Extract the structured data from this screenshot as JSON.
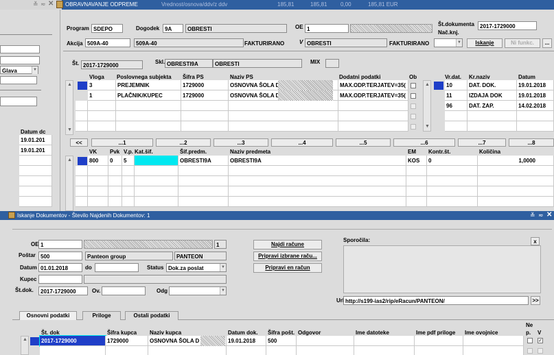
{
  "top_window": {
    "title": "OBRAVNAVANJE ODPREME",
    "title_info": "Vrednost/osnova/ddv/z ddv",
    "title_nums": [
      "185,81",
      "185,81",
      "0,00",
      "185,81 EUR"
    ]
  },
  "left_panel": {
    "glava": "Glava",
    "datum_header": "Datum dc",
    "datum_rows": [
      "19.01.201",
      "19.01.201"
    ]
  },
  "header": {
    "program_label": "Program",
    "program": "SDEPO",
    "dogodek_label": "Dogodek",
    "dogodek": "9A",
    "dogodek_name": "OBRESTI",
    "oe_label": "OE",
    "oe": "1",
    "st_dok_label": "Št.dokumenta",
    "st_dok": "2017-1729000",
    "nac_knj": "Nač.knj.",
    "akcija_label": "Akcija",
    "akcija": "509A-40",
    "akcija2": "509A-40",
    "fakturirano1": "FAKTURIRANO",
    "v_label": "V",
    "v_value": "OBRESTI",
    "fakturirano2": "FAKTURIRANO",
    "iskanje": "Iskanje",
    "ni_funkc": "Ni funkc."
  },
  "st_row": {
    "st_label": "Št.",
    "st": "2017-1729000",
    "skl_label": "Skl.",
    "skl": "OBRESTI9A",
    "skl_name": "OBRESTI",
    "mix": "MIX"
  },
  "subjects": {
    "headers": [
      "Vloga",
      "Poslovnega subjekta",
      "Šifra PS",
      "Naziv PS",
      "Dodatni podatki",
      "Ob"
    ],
    "rows": [
      [
        "3",
        "PREJEMNIK",
        "1729000",
        "OSNOVNA ŠOLA D",
        "MAX.ODP.TERJATEV=35("
      ],
      [
        "1",
        "PLAČNIK/KUPEC",
        "1729000",
        "OSNOVNA ŠOLA D",
        "MAX.ODP.TERJATEV=35("
      ]
    ]
  },
  "dates": {
    "headers": [
      "Vr.dat.",
      "Kr.naziv",
      "Datum"
    ],
    "rows": [
      [
        "10",
        "DAT. DOK.",
        "19.01.2018"
      ],
      [
        "11",
        "IZDAJA DOK",
        "19.01.2018"
      ],
      [
        "96",
        "DAT. ZAP.",
        "14.02.2018"
      ]
    ]
  },
  "nav": [
    "<<",
    "...1",
    "...2",
    "...3",
    "...4",
    "...5",
    "...6",
    "...7",
    "...8"
  ],
  "items": {
    "headers": [
      "VK",
      "Pvk",
      "V.p.",
      "Kat.šif.",
      "Šif.predm.",
      "Naziv predmeta",
      "EM",
      "Kontr.št.",
      "Količina"
    ],
    "row": [
      "800",
      "0",
      "5",
      "",
      "OBRESTI9A",
      "OBRESTI9A",
      "KOS",
      "0",
      "1,0000"
    ]
  },
  "dialog": {
    "title": "Iskanje Dokumentov - Število Najdenih Dokumentov: 1",
    "oe_label": "OE",
    "oe": "1",
    "oe_right": "1",
    "postar_label": "Poštar",
    "postar": "500",
    "postar_name": "Panteon group",
    "postar_code": "PANTEON",
    "datum_label": "Datum",
    "datum": "01.01.2018",
    "do_label": "do",
    "status_label": "Status",
    "status": "Dok.za poslat",
    "kupec_label": "Kupec",
    "stdok_label": "Št.dok.",
    "stdok": "2017-1729000",
    "ov_label": "Ov.",
    "odg_label": "Odg",
    "btn_najdi": "Najdi račune",
    "btn_pripravi_izbrane": "Pripravi izbrane raču...",
    "btn_pripravi_en": "Pripravi en račun",
    "sporocila": "Sporočila:",
    "x": "x",
    "url_label": "Url",
    "url": "http://s199-ias2/rip/eRacun/PANTEON/",
    "url_btn": ">>",
    "tabs": [
      "Osnovni podatki",
      "Priloge",
      "Ostali podatki"
    ],
    "grid_headers": [
      "Št. dok",
      "Šifra kupca",
      "Naziv kupca",
      "Datum dok.",
      "Šifra pošt.",
      "Odgovor",
      "Ime datoteke",
      "Ime pdf priloge",
      "Ime ovojnice",
      "Ne",
      "p.",
      "V"
    ],
    "grid_row": [
      "2017-1729000",
      "1729000",
      "OSNOVNA ŠOLA D",
      "19.01.2018",
      "500"
    ]
  }
}
